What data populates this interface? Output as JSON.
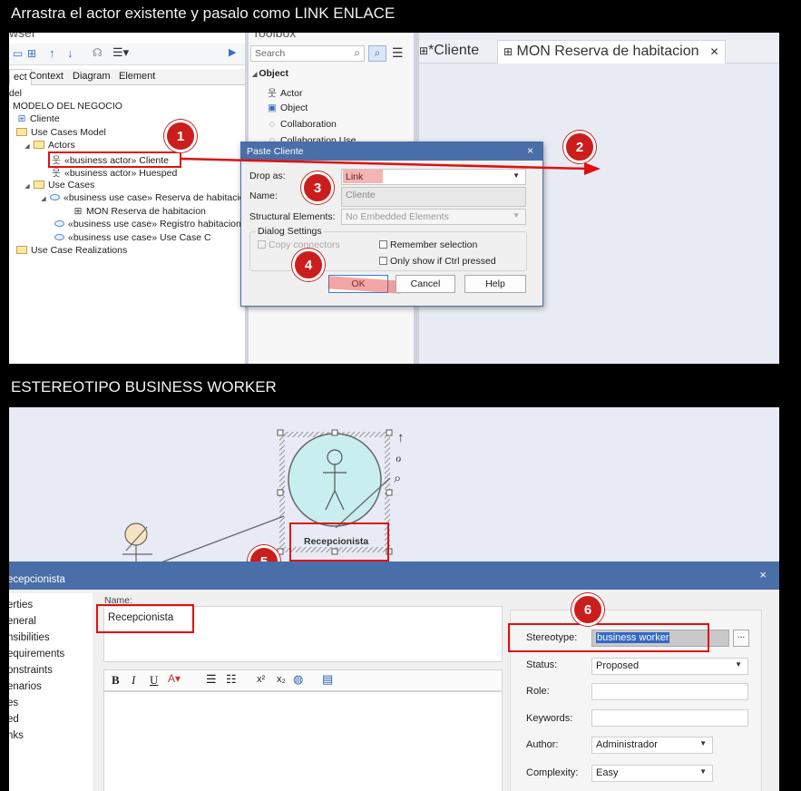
{
  "heading_top": "Arrastra el actor existente y pasalo como LINK ENLACE",
  "heading_bottom": "ESTEREOTIPO BUSINESS WORKER",
  "browser": {
    "header_partial": "wser",
    "tabs": [
      "ect",
      "Context",
      "Diagram",
      "Element"
    ],
    "tree": [
      "del",
      "MODELO DEL NEGOCIO",
      "Cliente",
      "Use Cases Model",
      "Actors",
      "«business actor» Cliente",
      "«business actor» Huesped",
      "Use Cases",
      "«business use case» Reserva de habitacion",
      "MON Reserva de habitacion",
      "«business use case» Registro habitacion",
      "«business use case» Use Case C",
      "Use Case Realizations"
    ]
  },
  "toolbox": {
    "header_partial": "Toolbox",
    "search_placeholder": "Search",
    "section": "Object",
    "items": [
      "Actor",
      "Object",
      "Collaboration",
      "Collaboration Use"
    ]
  },
  "diagram_tabs": [
    "*Cliente",
    "MON Reserva de habitacion"
  ],
  "paste_dialog": {
    "title": "Paste Cliente",
    "close": "×",
    "drop_as_label": "Drop as:",
    "drop_as_value": "Link",
    "name_label": "Name:",
    "name_value": "Cliente",
    "structural_label": "Structural Elements:",
    "structural_value": "No Embedded Elements",
    "group_label": "Dialog Settings",
    "copy_connectors": "Copy connectors",
    "remember_selection": "Remember selection",
    "only_show": "Only show if Ctrl pressed",
    "ok": "OK",
    "cancel": "Cancel",
    "help": "Help"
  },
  "callouts": [
    "1",
    "2",
    "3",
    "4",
    "5",
    "6"
  ],
  "diagram2": {
    "worker_name": "Recepcionista"
  },
  "props_window": {
    "title": "ecepcionista",
    "close": "×",
    "sidebar": [
      "erties",
      "eneral",
      "nsibilities",
      "equirements",
      "onstraints",
      "enarios",
      "es",
      "ed",
      "nks"
    ],
    "name_label": "Name:",
    "name_value": "Recepcionista",
    "stereotype_label": "Stereotype:",
    "stereotype_value": "business worker",
    "stereotype_btn": "...",
    "status_label": "Status:",
    "status_value": "Proposed",
    "role_label": "Role:",
    "role_value": "",
    "keywords_label": "Keywords:",
    "keywords_value": "",
    "author_label": "Author:",
    "author_value": "Administrador",
    "complexity_label": "Complexity:",
    "complexity_value": "Easy",
    "toolbar": [
      "B",
      "I",
      "U"
    ]
  },
  "colors": {
    "callout": "#cc1d1d",
    "highlight_box": "#e01010",
    "canvas": "#e8ebf5",
    "dialog_title": "#4a6ea8"
  }
}
